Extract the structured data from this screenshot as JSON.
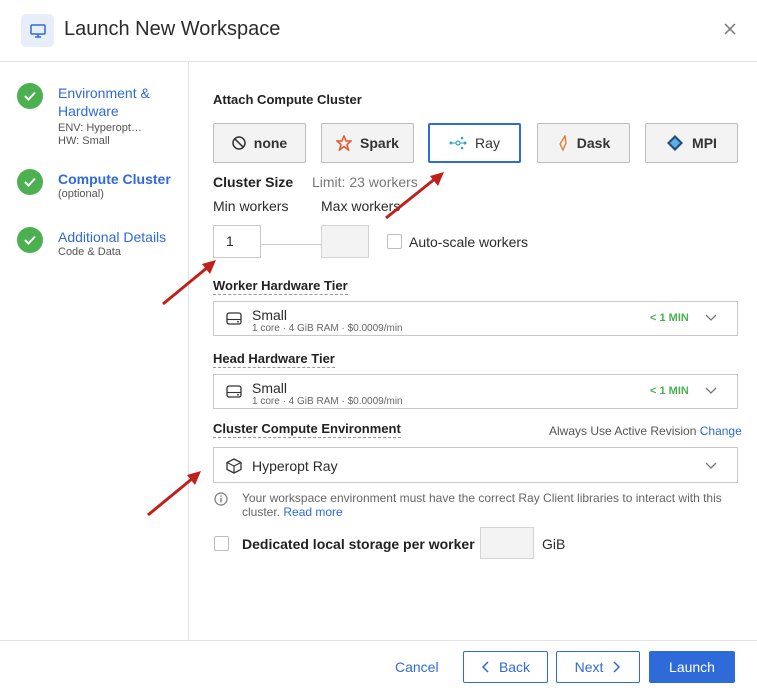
{
  "header": {
    "title": "Launch New Workspace",
    "icon": "monitor-icon",
    "close_icon": "close-icon"
  },
  "sidebar": {
    "steps": [
      {
        "title": "Environment & Hardware",
        "lines": [
          "ENV: Hyperopt…",
          "HW: Small"
        ]
      },
      {
        "title": "Compute Cluster",
        "lines": [
          "(optional)"
        ]
      },
      {
        "title": "Additional Details",
        "lines": [
          "Code & Data"
        ]
      }
    ]
  },
  "attach": {
    "label": "Attach Compute Cluster",
    "options": [
      {
        "label": "none",
        "icon": "ban-icon"
      },
      {
        "label": "Spark",
        "icon": "spark-icon"
      },
      {
        "label": "Ray",
        "icon": "ray-icon",
        "selected": true
      },
      {
        "label": "Dask",
        "icon": "dask-icon"
      },
      {
        "label": "MPI",
        "icon": "mpi-icon"
      }
    ]
  },
  "cluster_size": {
    "label": "Cluster Size",
    "limit": "Limit: 23 workers",
    "min_label": "Min workers",
    "max_label": "Max workers",
    "min_value": "1",
    "max_value": "",
    "autoscale_label": "Auto-scale workers"
  },
  "worker_tier": {
    "label": "Worker Hardware Tier",
    "name": "Small",
    "detail": "1 core · 4 GiB RAM · $0.0009/min",
    "time": "< 1 MIN"
  },
  "head_tier": {
    "label": "Head Hardware Tier",
    "name": "Small",
    "detail": "1 core · 4 GiB RAM · $0.0009/min",
    "time": "< 1 MIN"
  },
  "compute_env": {
    "label": "Cluster Compute Environment",
    "always_use": "Always Use Active Revision",
    "change": "Change",
    "value": "Hyperopt Ray",
    "info_line1": "Your workspace environment must have the correct Ray Client libraries to interact with this",
    "info_line2": "cluster.",
    "read_more": "Read more"
  },
  "storage": {
    "label": "Dedicated local storage per worker",
    "unit": "GiB",
    "value": ""
  },
  "footer": {
    "cancel": "Cancel",
    "back": "Back",
    "next": "Next",
    "launch": "Launch"
  },
  "colors": {
    "accent": "#2f6ad9",
    "success": "#4caf50",
    "annotation_arrow": "#c0201c"
  }
}
